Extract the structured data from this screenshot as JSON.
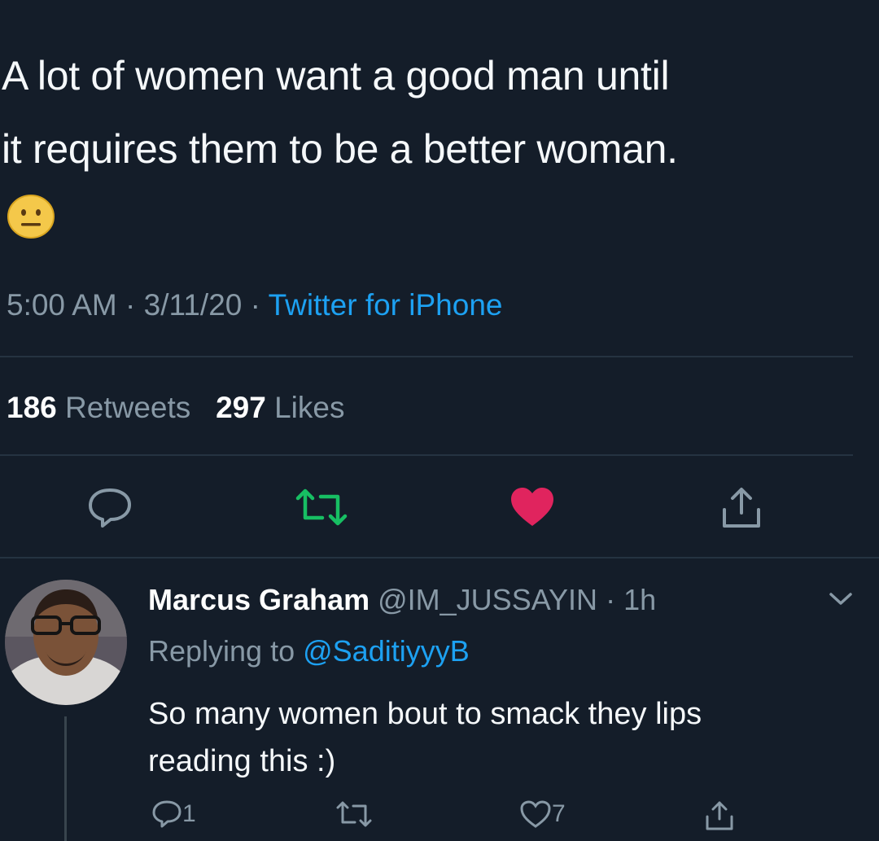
{
  "tweet": {
    "text_line1": "A lot of women want a good man until",
    "text_line2": "it requires them to be a better woman.",
    "emoji": "neutral-face",
    "time": "5:00 AM",
    "date": "3/11/20",
    "source": "Twitter for iPhone",
    "separator": "·",
    "retweet_count": "186",
    "retweet_label": "Retweets",
    "like_count": "297",
    "like_label": "Likes"
  },
  "actions": {
    "reply_icon": "comment-icon",
    "retweet_icon": "retweet-icon",
    "like_icon": "heart-icon",
    "share_icon": "share-icon"
  },
  "reply": {
    "name": "Marcus Graham",
    "handle": "@IM_JUSSAYIN",
    "separator": "·",
    "time": "1h",
    "replying_label": "Replying to",
    "replying_to": "@SaditiyyyB",
    "text_line1": "So many women bout to smack they lips",
    "text_line2": "reading this :)",
    "reply_count": "1",
    "like_count": "7"
  },
  "colors": {
    "background": "#141d29",
    "text": "#f5f8fa",
    "secondary": "#8899a6",
    "accent": "#1da1f2",
    "retweet_green": "#17bf63",
    "like_red": "#e0245e",
    "divider": "#253341"
  }
}
